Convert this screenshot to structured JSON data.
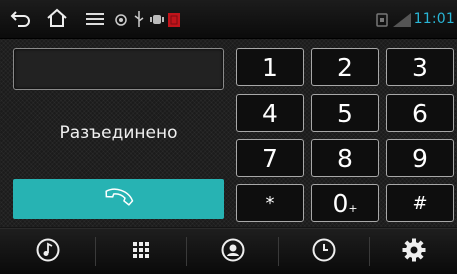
{
  "status_bar": {
    "time": "11:01",
    "icons": [
      "back-icon",
      "home-icon",
      "menu-icon",
      "gps-icon",
      "usb-icon",
      "android-debug-icon",
      "notification-icon",
      "sim-icon",
      "signal-icon"
    ]
  },
  "dialer": {
    "number_value": "",
    "call_status": "Разъединено",
    "keys": [
      "1",
      "2",
      "3",
      "4",
      "5",
      "6",
      "7",
      "8",
      "9",
      "*",
      "0",
      "#"
    ],
    "zero_sub": "+"
  },
  "colors": {
    "accent": "#27b3b3",
    "clock": "#29b6d6",
    "background": "#1b1b1b"
  },
  "bottom_nav": [
    "music-icon",
    "keypad-icon",
    "contacts-icon",
    "history-icon",
    "settings-icon"
  ]
}
